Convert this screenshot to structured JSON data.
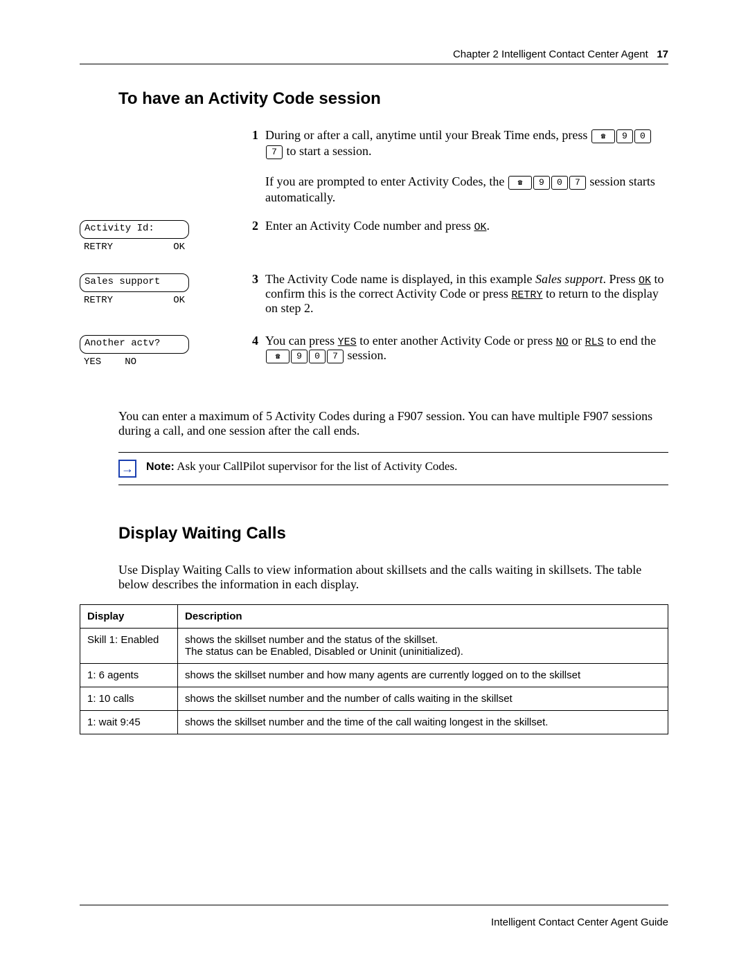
{
  "header": {
    "chapter": "Chapter 2  Intelligent Contact Center Agent",
    "page": "17"
  },
  "section1": {
    "title": "To have an Activity Code session",
    "step1": {
      "num": "1",
      "p1a": "During or after a call, anytime until your Break Time ends, press ",
      "p1b": " to start a session.",
      "p2a": "If you are prompted to enter Activity Codes, the ",
      "p2b": " session starts automatically."
    },
    "keycode": {
      "d1": "9",
      "d2": "0",
      "d3": "7"
    },
    "lcd1": {
      "line": "Activity Id:",
      "left": "RETRY",
      "right": "OK"
    },
    "lcd2": {
      "line": "Sales support",
      "left": "RETRY",
      "right": "OK"
    },
    "lcd3": {
      "line": "Another actv?",
      "left": "YES",
      "right": "NO"
    },
    "step2": {
      "num": "2",
      "text_a": "Enter an Activity Code number and press ",
      "ok": "OK",
      "text_b": "."
    },
    "step3": {
      "num": "3",
      "t1": "The Activity Code name is displayed, in this example ",
      "italic": "Sales support",
      "t2": ". Press ",
      "ok": "OK",
      "t3": " to confirm this is the correct Activity Code or press ",
      "retry": "RETRY",
      "t4": " to return to the display on step 2."
    },
    "step4": {
      "num": "4",
      "t1": "You can press ",
      "yes": "YES",
      "t2": " to enter another Activity Code or press ",
      "no": "NO",
      "t3": " or ",
      "rls": "RLS",
      "t4": " to end the ",
      "t5": " session."
    },
    "body": "You can enter a maximum of 5 Activity Codes during a F907 session. You can have multiple F907 sessions during a call, and one session after the call ends.",
    "note": {
      "label": "Note:",
      "text": " Ask your CallPilot supervisor for the list of Activity Codes."
    }
  },
  "section2": {
    "title": "Display Waiting Calls",
    "intro": "Use Display Waiting Calls to view information about skillsets and the calls waiting in skillsets. The table below describes the information in each display.",
    "table": {
      "head": {
        "c1": "Display",
        "c2": "Description"
      },
      "rows": [
        {
          "c1": "Skill 1: Enabled",
          "c2": "shows the skillset number and the status of the skillset.\nThe status can be Enabled, Disabled or Uninit (uninitialized)."
        },
        {
          "c1": "1: 6 agents",
          "c2": "shows the skillset number and how many agents are currently logged on to the skillset"
        },
        {
          "c1": "1: 10 calls",
          "c2": "shows the skillset number and the number of calls waiting in the skillset"
        },
        {
          "c1": "1: wait 9:45",
          "c2": "shows the skillset number and the time of the call waiting longest in the skillset."
        }
      ]
    }
  },
  "footer": "Intelligent Contact Center Agent Guide"
}
